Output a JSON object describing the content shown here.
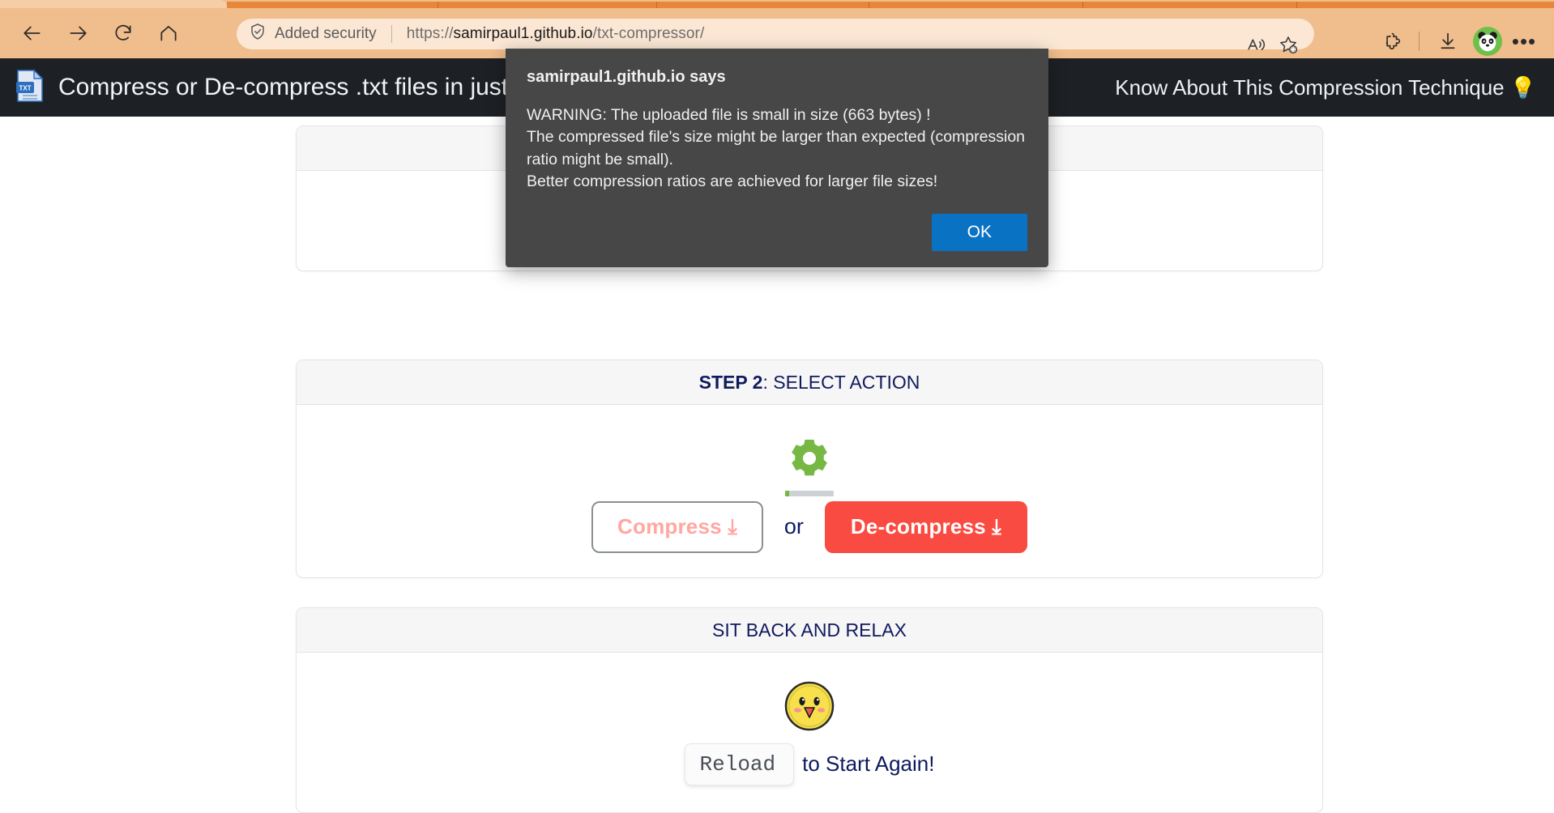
{
  "browser": {
    "nav": {
      "back": "back-arrow",
      "forward": "forward-arrow",
      "reload": "reload-arrow",
      "home": "home-shape"
    },
    "address": {
      "security_label": "Added security",
      "url_scheme": "https://",
      "url_host": "samirpaul1.github.io",
      "url_path": "/txt-compressor/",
      "full_url": "https://samirpaul1.github.io/txt-compressor/"
    },
    "toolbar_icons": [
      "read-aloud-icon",
      "add-favorite-icon",
      "extensions-icon",
      "downloads-icon",
      "profile-avatar-panda",
      "settings-more-icon"
    ],
    "colors": {
      "chrome_bg": "#f0bd8c",
      "tab_strip": "#e8873a",
      "address_bg": "#fbe7d4"
    }
  },
  "site": {
    "navbar": {
      "icon": "txt-file-icon",
      "title": "Compress or De-compress .txt files in just",
      "link_text": "Know About This Compression Technique",
      "link_icon": "lightbulb-icon"
    },
    "colors": {
      "navbar_bg": "#1d2125",
      "heading": "#111a5c",
      "accent_red": "#f94b41",
      "disabled_pink": "#ffa7a0",
      "gear_green": "#76b843"
    }
  },
  "cards": {
    "step1": {
      "header": "",
      "header_bold": ""
    },
    "step2": {
      "header_bold": "STEP 2",
      "header_rest": ": SELECT ACTION",
      "gear_icon": "gear-icon",
      "progress_percent": 8,
      "compress_label": "Compress ⤓",
      "or_label": "or",
      "decompress_label": "De-compress ⤓"
    },
    "relax": {
      "header_bold": "",
      "header_rest": "SIT BACK AND RELAX",
      "emoji": "happy-face-emoji",
      "reload_label": "Reload",
      "reload_suffix": "to Start Again!"
    }
  },
  "dialog": {
    "title": "samirpaul1.github.io says",
    "message": "WARNING: The uploaded file is small in size (663 bytes) !\nThe compressed file's size might be larger than expected (compression ratio might be small).\nBetter compression ratios are achieved for larger file sizes!",
    "ok_label": "OK",
    "ok_color": "#0a72c3",
    "bg_color": "#474747"
  }
}
